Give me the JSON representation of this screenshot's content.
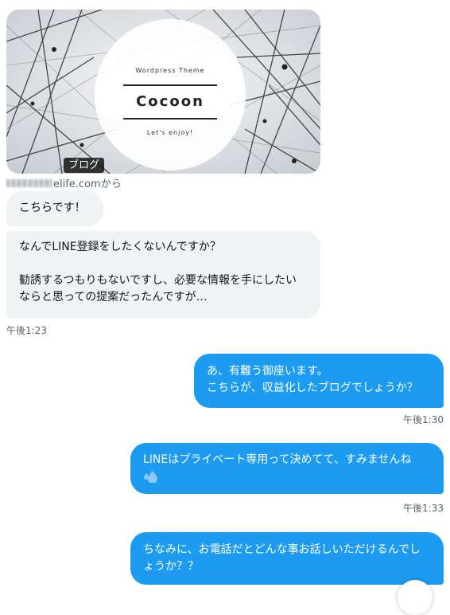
{
  "link_card": {
    "brand_top": "Wordpress Theme",
    "brand_name": "Cocoon",
    "brand_bottom": "Let's enjoy!",
    "tag": "ブログ",
    "source_domain": "elife.comから"
  },
  "messages": [
    {
      "direction": "received",
      "text": "こちらです！"
    },
    {
      "direction": "received",
      "text": "なんでLINE登録をしたくないんですか？\n\n勧誘するつもりもないですし、必要な情報を手にしたいならと思っての提案だったんですが…",
      "time": "午後1:23"
    },
    {
      "direction": "sent",
      "text": "あ、有難う御座います。\nこちらが、収益化したブログでしょうか？",
      "time": "午後1:30"
    },
    {
      "direction": "sent",
      "text": "LINEはプライベート専用って決めてて、すみませんね",
      "emoji": "sweat-droplets-icon",
      "time": "午後1:33"
    },
    {
      "direction": "sent",
      "text": "ちなみに、お電話だとどんな事お話しいただけるんでしょうか？？"
    }
  ],
  "colors": {
    "sent_bubble": "#1d9bf0",
    "received_bubble": "#eff3f4",
    "timestamp": "#536471"
  }
}
